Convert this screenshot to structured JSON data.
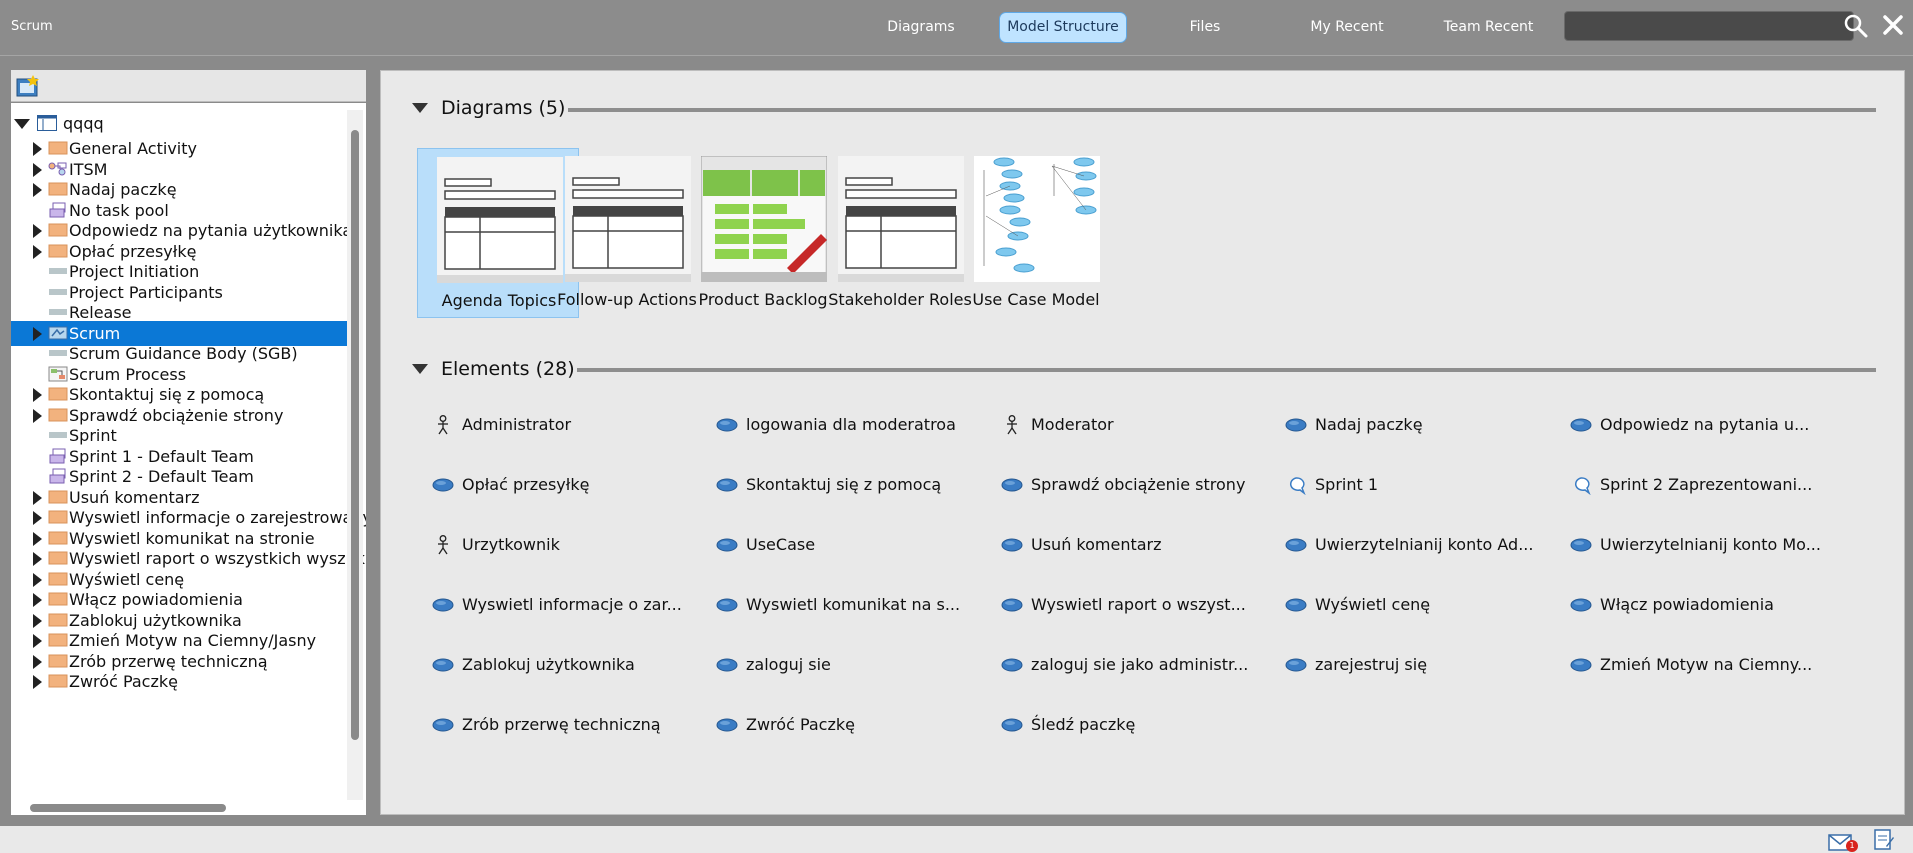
{
  "app": {
    "title": "Scrum"
  },
  "nav": {
    "tabs": [
      {
        "label": "Diagrams",
        "active": false
      },
      {
        "label": "Model Structure",
        "active": true
      },
      {
        "label": "Files",
        "active": false
      },
      {
        "label": "My Recent",
        "active": false
      },
      {
        "label": "Team Recent",
        "active": false
      }
    ],
    "search_value": ""
  },
  "tree": {
    "root": "qqqq",
    "items": [
      {
        "label": "General Activity",
        "icon": "folder-icon",
        "expandable": true
      },
      {
        "label": "ITSM",
        "icon": "process-icon",
        "expandable": true
      },
      {
        "label": "Nadaj paczkę",
        "icon": "folder-icon",
        "expandable": true
      },
      {
        "label": "No task pool",
        "icon": "task-pool-icon",
        "expandable": false
      },
      {
        "label": "Odpowiedz na pytania użytkownika",
        "icon": "folder-icon",
        "expandable": true
      },
      {
        "label": "Opłać przesyłkę",
        "icon": "folder-icon",
        "expandable": true
      },
      {
        "label": "Project Initiation",
        "icon": "bar-icon",
        "expandable": false
      },
      {
        "label": "Project Participants",
        "icon": "bar-icon",
        "expandable": false
      },
      {
        "label": "Release",
        "icon": "bar-icon",
        "expandable": false
      },
      {
        "label": "Scrum",
        "icon": "scrum-folder-icon",
        "expandable": true,
        "selected": true
      },
      {
        "label": "Scrum Guidance Body (SGB)",
        "icon": "bar-icon",
        "expandable": false
      },
      {
        "label": "Scrum Process",
        "icon": "process-diagram-icon",
        "expandable": false
      },
      {
        "label": "Skontaktuj się z pomocą",
        "icon": "folder-icon",
        "expandable": true
      },
      {
        "label": "Sprawdź obciążenie strony",
        "icon": "folder-icon",
        "expandable": true
      },
      {
        "label": "Sprint",
        "icon": "bar-icon",
        "expandable": false
      },
      {
        "label": "Sprint 1 - Default Team",
        "icon": "task-pool-icon",
        "expandable": false
      },
      {
        "label": "Sprint 2 - Default Team",
        "icon": "task-pool-icon",
        "expandable": false
      },
      {
        "label": "Usuń komentarz",
        "icon": "folder-icon",
        "expandable": true
      },
      {
        "label": "Wyswietl informacje o zarejestrowanych",
        "icon": "folder-icon",
        "expandable": true
      },
      {
        "label": "Wyswietl komunikat na stronie",
        "icon": "folder-icon",
        "expandable": true
      },
      {
        "label": "Wyswietl raport o wszystkich wyszukiwaniach",
        "icon": "folder-icon",
        "expandable": true
      },
      {
        "label": "Wyświetl cenę",
        "icon": "folder-icon",
        "expandable": true
      },
      {
        "label": "Włącz powiadomienia",
        "icon": "folder-icon",
        "expandable": true
      },
      {
        "label": "Zablokuj użytkownika",
        "icon": "folder-icon",
        "expandable": true
      },
      {
        "label": "Zmień Motyw na Ciemny/Jasny",
        "icon": "folder-icon",
        "expandable": true
      },
      {
        "label": "Zrób przerwę techniczną",
        "icon": "folder-icon",
        "expandable": true
      },
      {
        "label": "Zwróć Paczkę",
        "icon": "folder-icon",
        "expandable": true
      }
    ]
  },
  "diagrams": {
    "header": "Diagrams (5)",
    "items": [
      {
        "label": "Agenda Topics",
        "thumb": "table-thumb-icon",
        "selected": true
      },
      {
        "label": "Follow-up Actions",
        "thumb": "table-thumb-icon",
        "selected": false
      },
      {
        "label": "Product Backlog",
        "thumb": "backlog-thumb-icon",
        "selected": false
      },
      {
        "label": "Stakeholder Roles",
        "thumb": "table-thumb-icon",
        "selected": false
      },
      {
        "label": "Use Case Model",
        "thumb": "usecase-thumb-icon",
        "selected": false
      }
    ]
  },
  "elements": {
    "header": "Elements (28)",
    "items": [
      {
        "label": "Administrator",
        "icon": "actor-icon"
      },
      {
        "label": "logowania dla moderatroa",
        "icon": "use-case-icon"
      },
      {
        "label": "Moderator",
        "icon": "actor-icon"
      },
      {
        "label": "Nadaj paczkę",
        "icon": "use-case-icon"
      },
      {
        "label": "Odpowiedz na pytania u...",
        "icon": "use-case-icon"
      },
      {
        "label": "Opłać przesyłkę",
        "icon": "use-case-icon"
      },
      {
        "label": "Skontaktuj się z pomocą",
        "icon": "use-case-icon"
      },
      {
        "label": "Sprawdź obciążenie strony",
        "icon": "use-case-icon"
      },
      {
        "label": "Sprint 1",
        "icon": "sprint-icon"
      },
      {
        "label": "Sprint 2 Zaprezentowani...",
        "icon": "sprint-icon"
      },
      {
        "label": "Urzytkownik",
        "icon": "actor-icon"
      },
      {
        "label": "UseCase",
        "icon": "use-case-icon"
      },
      {
        "label": "Usuń komentarz",
        "icon": "use-case-icon"
      },
      {
        "label": "Uwierzytelnianij konto Ad...",
        "icon": "use-case-icon"
      },
      {
        "label": "Uwierzytelnianij konto Mo...",
        "icon": "use-case-icon"
      },
      {
        "label": "Wyswietl informacje o zar...",
        "icon": "use-case-icon"
      },
      {
        "label": "Wyswietl komunikat na s...",
        "icon": "use-case-icon"
      },
      {
        "label": "Wyswietl raport o wszyst...",
        "icon": "use-case-icon"
      },
      {
        "label": "Wyświetl cenę",
        "icon": "use-case-icon"
      },
      {
        "label": "Włącz powiadomienia",
        "icon": "use-case-icon"
      },
      {
        "label": "Zablokuj użytkownika",
        "icon": "use-case-icon"
      },
      {
        "label": "zaloguj sie",
        "icon": "use-case-icon"
      },
      {
        "label": "zaloguj sie jako administr...",
        "icon": "use-case-icon"
      },
      {
        "label": "zarejestruj się",
        "icon": "use-case-icon"
      },
      {
        "label": "Zmień Motyw na Ciemny...",
        "icon": "use-case-icon"
      },
      {
        "label": "Zrób przerwę techniczną",
        "icon": "use-case-icon"
      },
      {
        "label": "Zwróć Paczkę",
        "icon": "use-case-icon"
      },
      {
        "label": "Śledź paczkę",
        "icon": "use-case-icon"
      }
    ]
  },
  "status": {
    "mail_count": "1"
  },
  "colors": {
    "accent": "#0b78d6",
    "active_tab": "#bfe3ff",
    "folder": "#f2b27e",
    "use_case": "#3a7cc4"
  }
}
